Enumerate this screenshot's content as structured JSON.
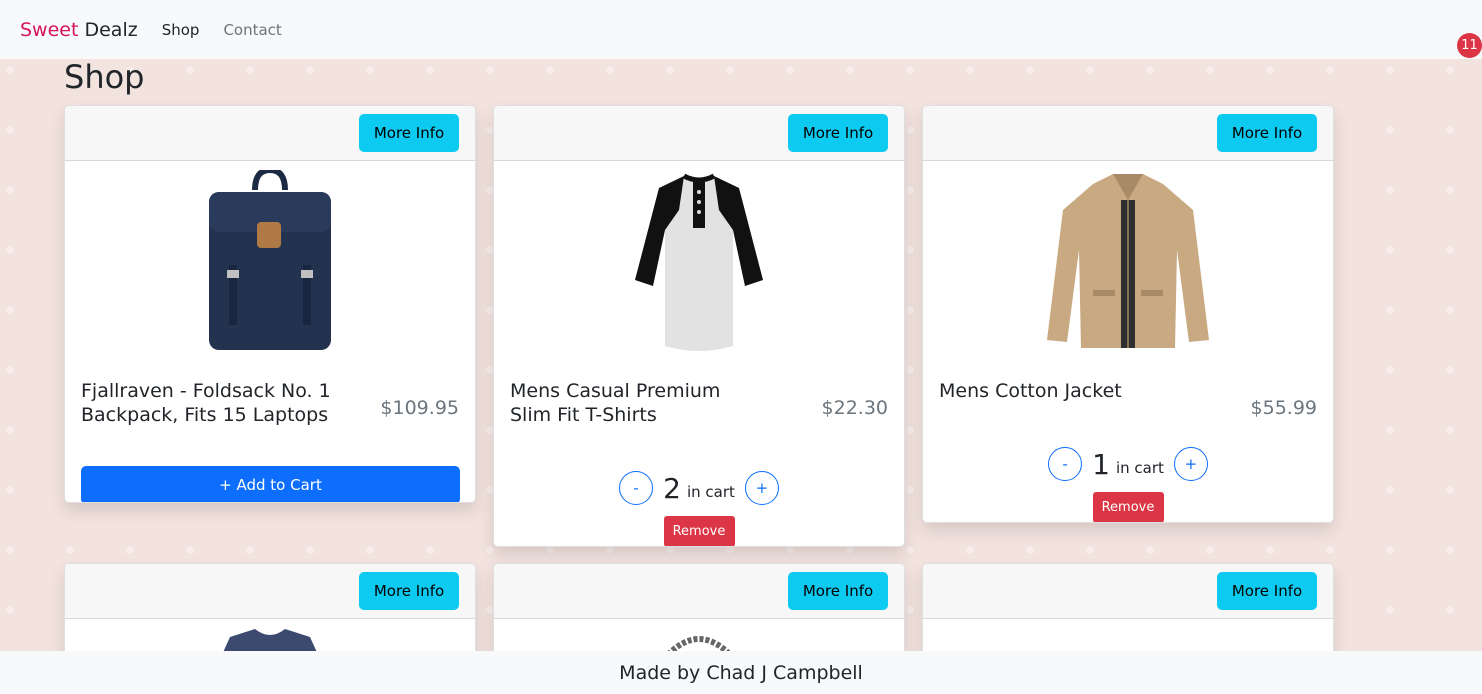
{
  "brand": {
    "part1": "Sweet",
    "part2": "Dealz"
  },
  "nav": {
    "items": [
      {
        "label": "Shop"
      },
      {
        "label": "Contact"
      }
    ]
  },
  "cart": {
    "count": "11",
    "icon": "cart-icon"
  },
  "page": {
    "title": "Shop"
  },
  "products": [
    {
      "title": "Fjallraven - Foldsack No. 1 Backpack, Fits 15 Laptops",
      "price": "$109.95",
      "more_info": "More Info",
      "add_label": "+ Add to Cart",
      "in_cart": false
    },
    {
      "title": "Mens Casual Premium Slim Fit T-Shirts",
      "price": "$22.30",
      "more_info": "More Info",
      "in_cart": true,
      "qty": "2",
      "qty_label": "in cart",
      "minus": "-",
      "plus": "+",
      "remove": "Remove"
    },
    {
      "title": "Mens Cotton Jacket",
      "price": "$55.99",
      "more_info": "More Info",
      "in_cart": true,
      "qty": "1",
      "qty_label": "in cart",
      "minus": "-",
      "plus": "+",
      "remove": "Remove"
    },
    {
      "more_info": "More Info"
    },
    {
      "more_info": "More Info"
    },
    {
      "more_info": "More Info"
    }
  ],
  "footer": {
    "text": "Made by Chad J Campbell"
  },
  "colors": {
    "brand_accent": "#d6135a",
    "primary": "#0d6efd",
    "info": "#0dcaf0",
    "danger": "#dc3545",
    "background": "#f3e3df"
  }
}
